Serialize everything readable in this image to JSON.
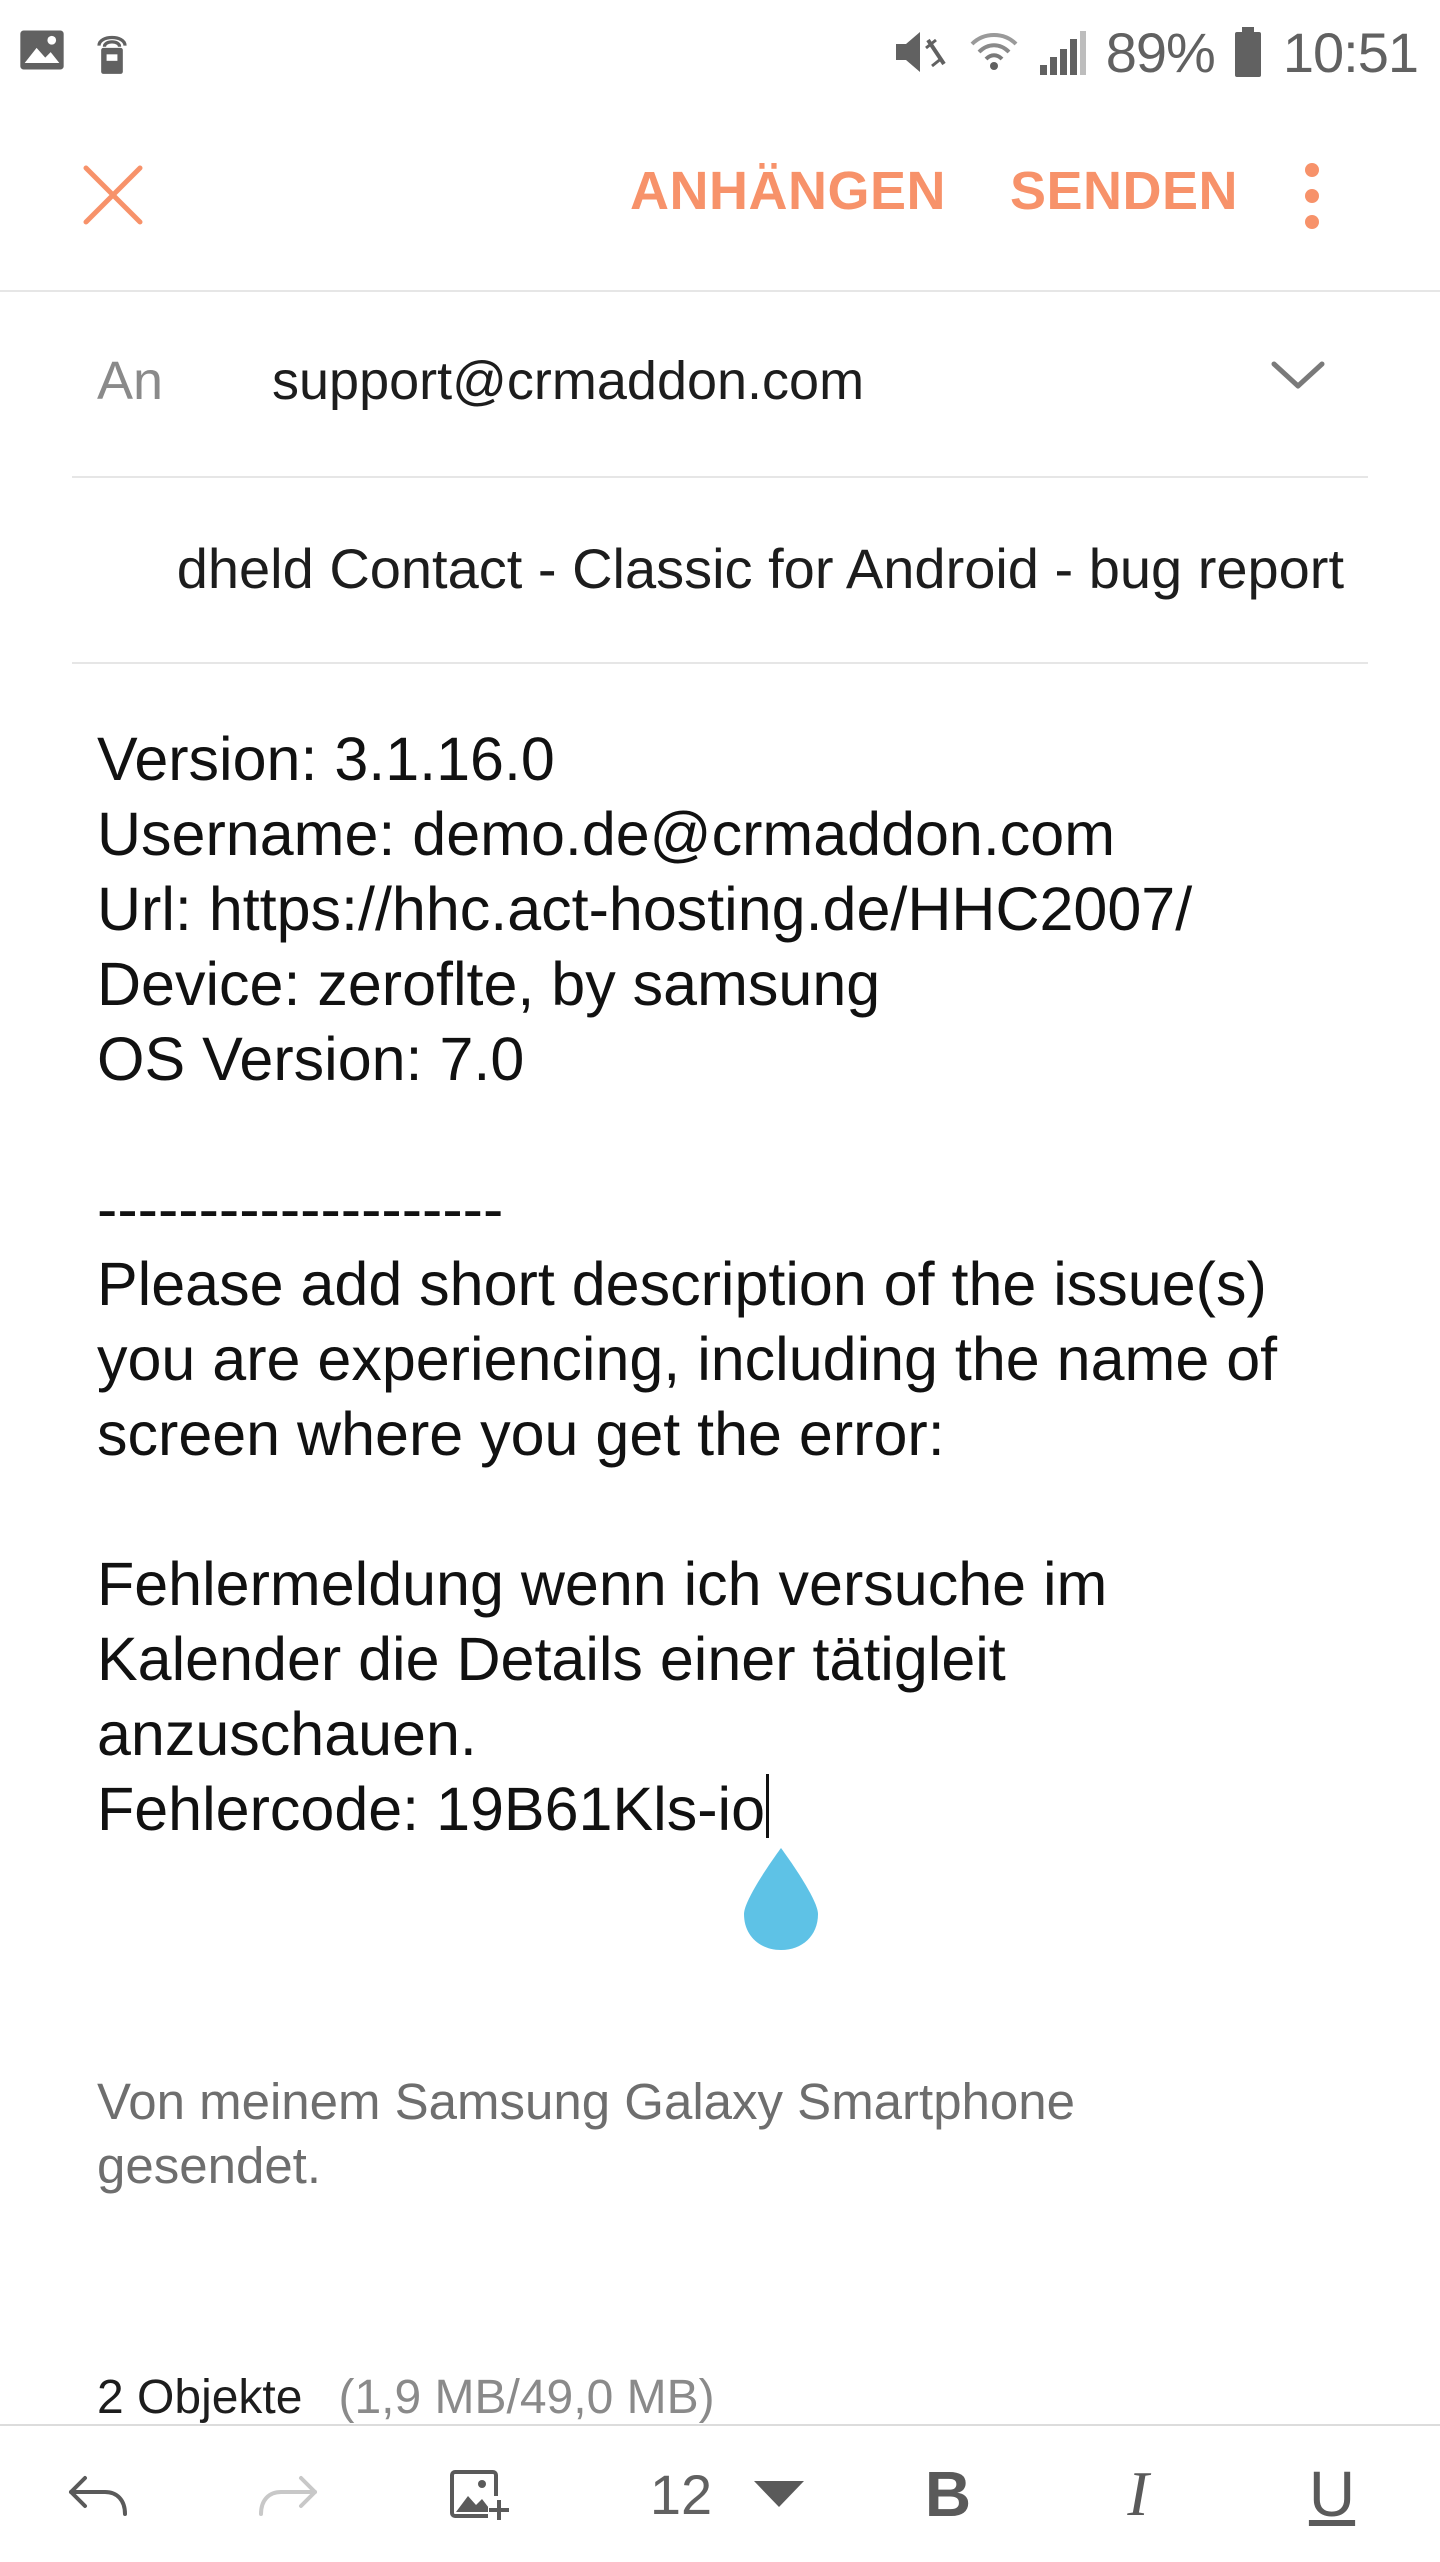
{
  "status_bar": {
    "battery_percent": "89%",
    "time": "10:51",
    "icons": [
      "image-icon",
      "remote-icon",
      "mute-icon",
      "wifi-icon",
      "signal-icon",
      "battery-icon"
    ]
  },
  "app_bar": {
    "attach_label": "ANHÄNGEN",
    "send_label": "SENDEN",
    "accent_color": "#f7926a"
  },
  "to": {
    "label": "An",
    "value": "support@crmaddon.com"
  },
  "subject": {
    "value": "dheld Contact - Classic for Android - bug report"
  },
  "body": {
    "lines": [
      "Version: 3.1.16.0",
      "Username: demo.de@crmaddon.com",
      "Url: https://hhc.act-hosting.de/HHC2007/",
      "Device: zeroflte, by samsung",
      "OS Version: 7.0",
      "",
      "--------------------",
      "Please add short description of the issue(s)",
      "you are experiencing, including the name of",
      "screen where you get the error:",
      "",
      "Fehlermeldung wenn ich versuche im",
      "Kalender die Details einer tätigleit",
      "anzuschauen.",
      "Fehlercode: 19B61Kls-io"
    ]
  },
  "signature": {
    "text": "Von meinem Samsung Galaxy Smartphone gesendet."
  },
  "attachments": {
    "count_label": "2 Objekte",
    "size_label": "(1,9 MB/49,0 MB)"
  },
  "toolbar": {
    "font_size": "12",
    "bold": "B",
    "italic": "I",
    "underline": "U"
  }
}
